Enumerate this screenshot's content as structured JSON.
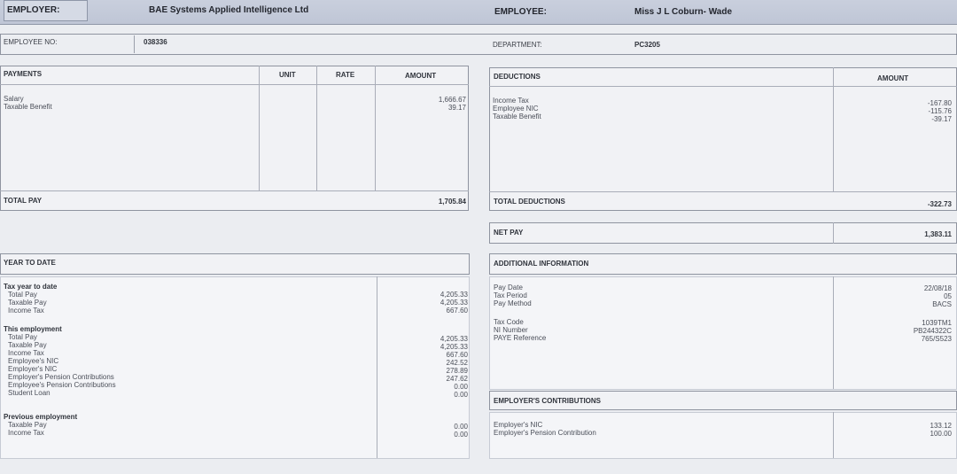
{
  "header": {
    "employer_label": "EMPLOYER:",
    "employer_value": "BAE Systems Applied Intelligence Ltd",
    "employee_label": "EMPLOYEE:",
    "employee_value": "Miss J L Coburn- Wade",
    "employee_no_label": "EMPLOYEE NO:",
    "employee_no_value": "038336",
    "department_label": "DEPARTMENT:",
    "department_value": "PC3205"
  },
  "payments": {
    "title": "PAYMENTS",
    "col_unit": "UNIT",
    "col_rate": "RATE",
    "col_amount": "AMOUNT",
    "items": [
      {
        "label": "Salary",
        "amount": "1,666.67"
      },
      {
        "label": "Taxable Benefit",
        "amount": "39.17"
      }
    ],
    "total_label": "TOTAL PAY",
    "total_value": "1,705.84"
  },
  "deductions": {
    "title": "DEDUCTIONS",
    "col_amount": "AMOUNT",
    "items": [
      {
        "label": "Income Tax",
        "amount": "-167.80"
      },
      {
        "label": "Employee NIC",
        "amount": "-115.76"
      },
      {
        "label": "Taxable Benefit",
        "amount": "-39.17"
      }
    ],
    "total_label": "TOTAL DEDUCTIONS",
    "total_value": "-322.73",
    "net_label": "NET PAY",
    "net_value": "1,383.11"
  },
  "ytd": {
    "title": "YEAR TO DATE",
    "tax_year_heading": "Tax year to date",
    "tax_year_items": [
      {
        "label": "Total Pay",
        "value": "4,205.33"
      },
      {
        "label": "Taxable Pay",
        "value": "4,205.33"
      },
      {
        "label": "Income Tax",
        "value": "667.60"
      }
    ],
    "this_emp_heading": "This employment",
    "this_emp_items": [
      {
        "label": "Total Pay",
        "value": "4,205.33"
      },
      {
        "label": "Taxable Pay",
        "value": "4,205.33"
      },
      {
        "label": "Income Tax",
        "value": "667.60"
      },
      {
        "label": "Employee's NIC",
        "value": "242.52"
      },
      {
        "label": "Employer's NIC",
        "value": "278.89"
      },
      {
        "label": "Employer's Pension Contributions",
        "value": "247.62"
      },
      {
        "label": "Employee's Pension Contributions",
        "value": "0.00"
      },
      {
        "label": "Student Loan",
        "value": "0.00"
      }
    ],
    "prev_emp_heading": "Previous employment",
    "prev_emp_items": [
      {
        "label": "Taxable Pay",
        "value": "0.00"
      },
      {
        "label": "Income Tax",
        "value": "0.00"
      }
    ]
  },
  "additional": {
    "title": "ADDITIONAL INFORMATION",
    "group1": [
      {
        "label": "Pay Date",
        "value": "22/08/18"
      },
      {
        "label": "Tax Period",
        "value": "05"
      },
      {
        "label": "Pay Method",
        "value": "BACS"
      }
    ],
    "group2": [
      {
        "label": "Tax Code",
        "value": "1039TM1"
      },
      {
        "label": "NI Number",
        "value": "PB244322C"
      },
      {
        "label": "PAYE Reference",
        "value": "765/S523"
      }
    ]
  },
  "employer_contrib": {
    "title": "EMPLOYER'S CONTRIBUTIONS",
    "items": [
      {
        "label": "Employer's NIC",
        "value": "133.12"
      },
      {
        "label": "Employer's Pension Contribution",
        "value": "100.00"
      }
    ]
  }
}
